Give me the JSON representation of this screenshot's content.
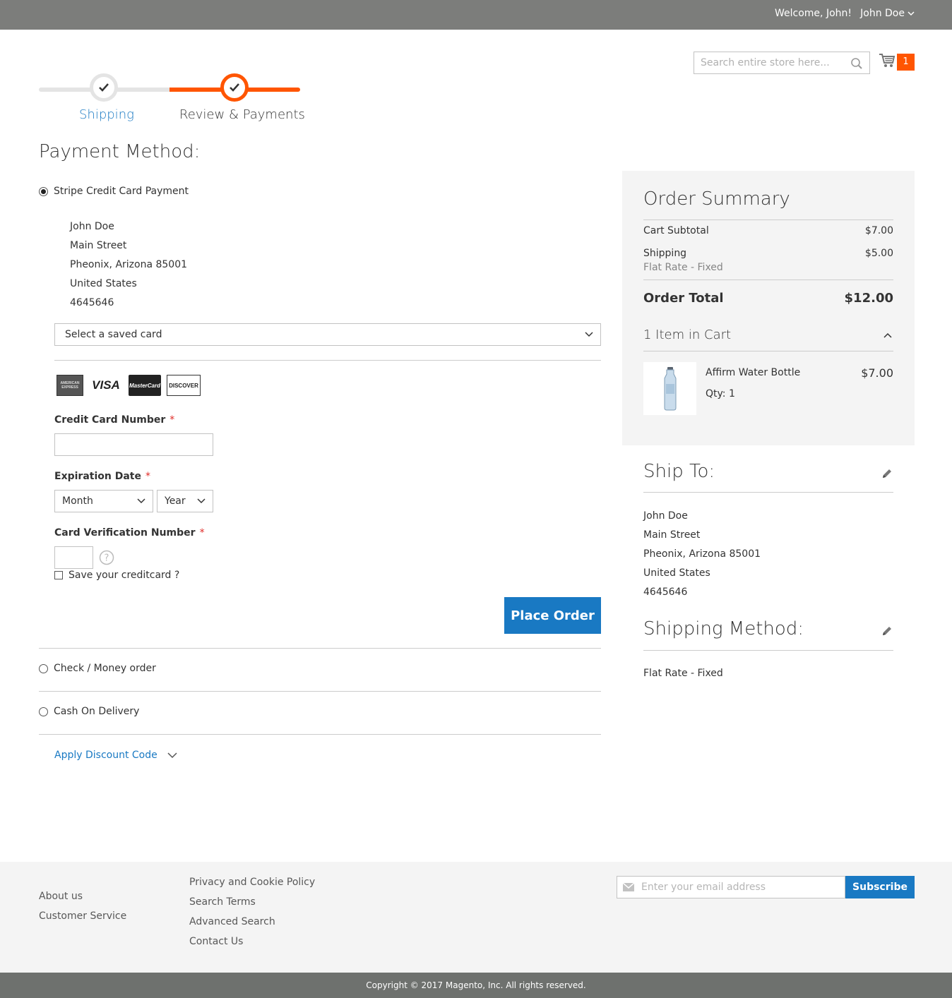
{
  "header": {
    "welcome": "Welcome, John!",
    "user_name": "John Doe",
    "search_placeholder": "Search entire store here...",
    "cart_count": "1"
  },
  "progress": {
    "steps": [
      {
        "label": "Shipping"
      },
      {
        "label": "Review & Payments"
      }
    ]
  },
  "payment": {
    "title": "Payment Method:",
    "methods": [
      {
        "label": "Stripe Credit Card Payment",
        "selected": true
      },
      {
        "label": "Check / Money order",
        "selected": false
      },
      {
        "label": "Cash On Delivery",
        "selected": false
      }
    ],
    "billing_address": [
      "John Doe",
      "Main Street",
      "Pheonix, Arizona 85001",
      "United States",
      "4645646"
    ],
    "saved_card_select": "Select a saved card",
    "card_logos": [
      "AMERICAN EXPRESS",
      "VISA",
      "MasterCard",
      "DISCOVER"
    ],
    "cc_number_label": "Credit Card Number",
    "required_mark": "*",
    "expiration_label": "Expiration Date",
    "month_select": "Month",
    "year_select": "Year",
    "cvv_label": "Card Verification Number",
    "save_card_label": "Save your creditcard ?",
    "place_order": "Place Order",
    "discount_link": "Apply Discount Code"
  },
  "summary": {
    "title": "Order Summary",
    "cart_subtotal_label": "Cart Subtotal",
    "cart_subtotal": "$7.00",
    "shipping_label": "Shipping",
    "shipping_method_sub": "Flat Rate - Fixed",
    "shipping_amount": "$5.00",
    "order_total_label": "Order Total",
    "order_total": "$12.00",
    "items_in_cart": "1 Item in Cart",
    "item": {
      "name": "Affirm Water Bottle",
      "qty": "Qty: 1",
      "price": "$7.00"
    }
  },
  "ship_to": {
    "title": "Ship To:",
    "address": [
      "John Doe",
      "Main Street",
      "Pheonix, Arizona 85001",
      "United States",
      "4645646"
    ]
  },
  "shipping_method": {
    "title": "Shipping Method:",
    "value": "Flat Rate - Fixed"
  },
  "footer": {
    "col1": [
      "About us",
      "Customer Service"
    ],
    "col2": [
      "Privacy and Cookie Policy",
      "Search Terms",
      "Advanced Search",
      "Contact Us"
    ],
    "email_placeholder": "Enter your email address",
    "subscribe": "Subscribe",
    "copyright": "Copyright © 2017 Magento, Inc. All rights reserved."
  },
  "colors": {
    "accent": "#ff5501",
    "primary": "#1979c3",
    "topbar": "#7c7d7b"
  }
}
